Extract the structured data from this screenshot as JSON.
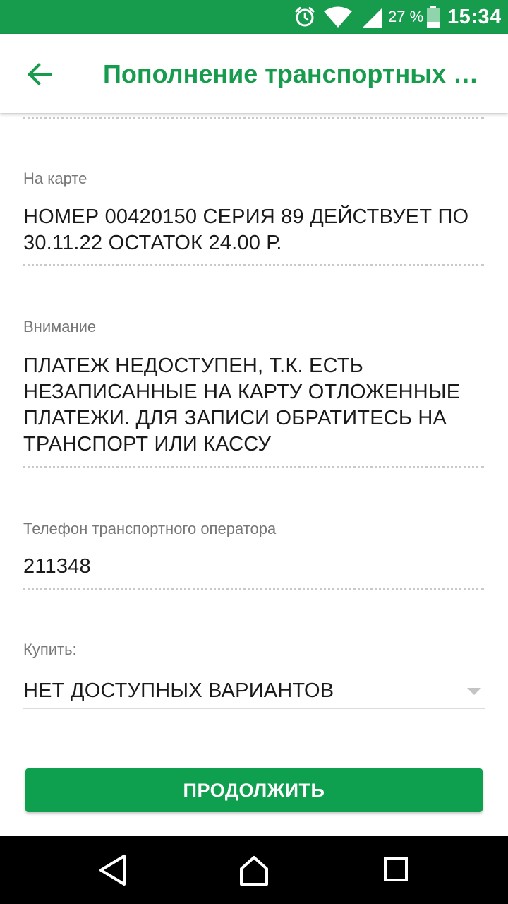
{
  "status_bar": {
    "icons": [
      "alarm-clock-icon",
      "wifi-icon",
      "cell-signal-icon",
      "battery-icon"
    ],
    "battery_percent": "27 %",
    "time": "15:34"
  },
  "header": {
    "back_icon": "arrow-left-icon",
    "title": "Пополнение транспортных карт"
  },
  "fields": [
    {
      "label": "На карте",
      "value": "НОМЕР 00420150 СЕРИЯ 89 ДЕЙСТВУЕТ ПО 30.11.22 ОСТАТОК 24.00 Р."
    },
    {
      "label": "Внимание",
      "value": "ПЛАТЕЖ НЕДОСТУПЕН, Т.К. ЕСТЬ НЕЗАПИСАННЫЕ НА КАРТУ ОТЛОЖЕННЫЕ ПЛАТЕЖИ. ДЛЯ ЗАПИСИ ОБРАТИТЕСЬ НА ТРАНСПОРТ ИЛИ КАССУ"
    },
    {
      "label": "Телефон транспортного оператора",
      "value": "211348"
    }
  ],
  "buy": {
    "label": "Купить:",
    "selected": "НЕТ ДОСТУПНЫХ ВАРИАНТОВ"
  },
  "actions": {
    "continue_label": "ПРОДОЛЖИТЬ"
  },
  "nav_bar": {
    "icons": [
      "nav-back-icon",
      "nav-home-icon",
      "nav-recents-icon"
    ]
  },
  "colors": {
    "brand_green": "#179b4c",
    "button_green": "#0ea04f",
    "label_gray": "#777777",
    "text_dark": "#1a1a1a"
  }
}
